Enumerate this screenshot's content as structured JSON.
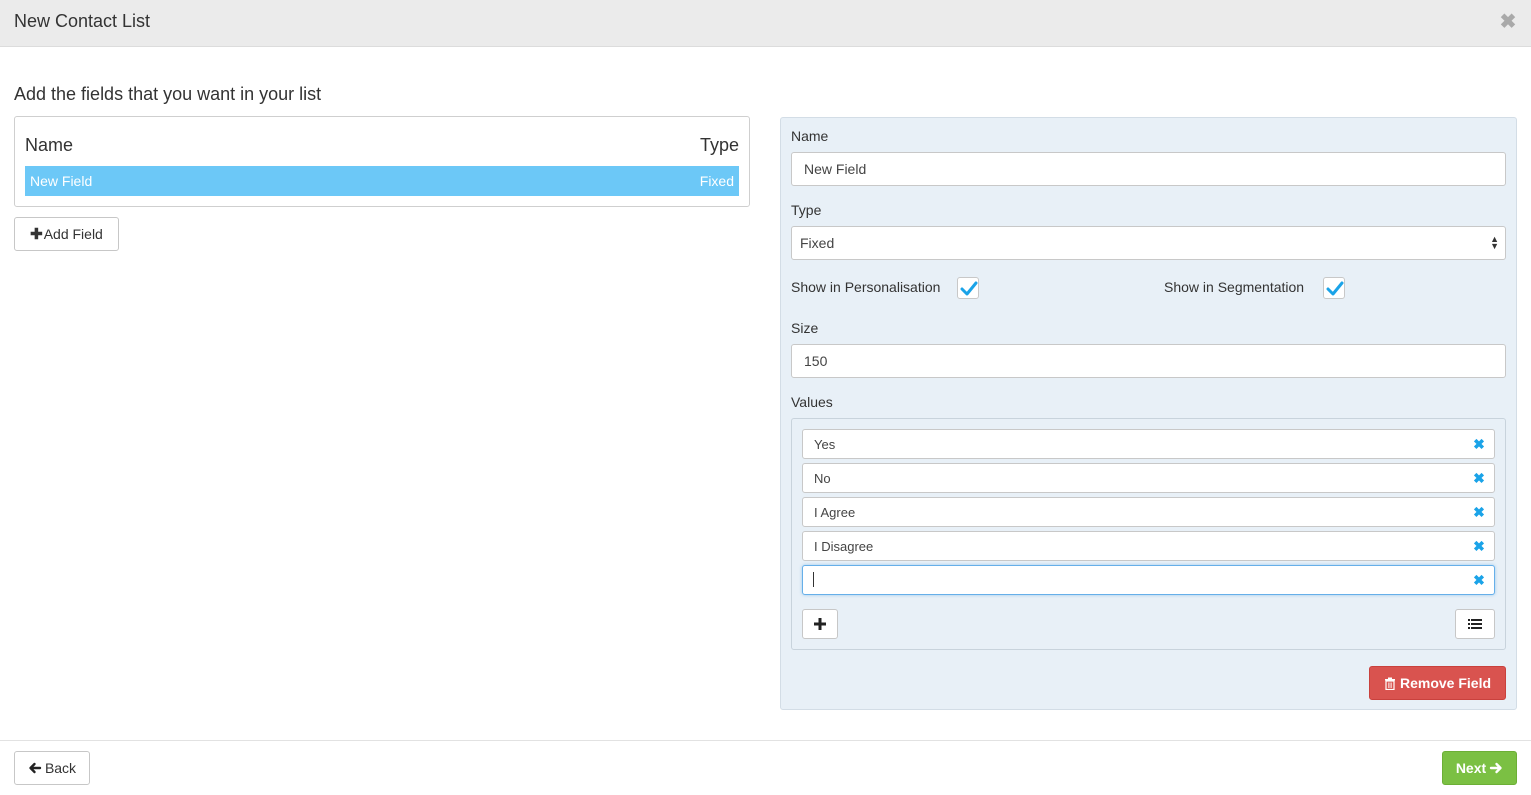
{
  "dialog": {
    "title": "New Contact List"
  },
  "instruction": "Add the fields that you want in your list",
  "field_table": {
    "columns": [
      "Name",
      "Type"
    ],
    "rows": [
      {
        "name": "New Field",
        "type": "Fixed"
      }
    ]
  },
  "add_field_label": "Add Field",
  "editor": {
    "name_label": "Name",
    "name_value": "New Field",
    "type_label": "Type",
    "type_value": "Fixed",
    "show_personalisation_label": "Show in Personalisation",
    "show_personalisation_checked": true,
    "show_segmentation_label": "Show in Segmentation",
    "show_segmentation_checked": true,
    "size_label": "Size",
    "size_value": "150",
    "values_label": "Values",
    "values": [
      "Yes",
      "No",
      "I Agree",
      "I Disagree",
      ""
    ],
    "remove_field_label": "Remove Field"
  },
  "footer": {
    "back_label": "Back",
    "next_label": "Next"
  },
  "colors": {
    "selection": "#6cc8f7",
    "panel": "#e8f0f7",
    "danger": "#d9534f",
    "success": "#7bc043",
    "checkmark": "#1aa3e8"
  },
  "icons": [
    "close-icon",
    "plus-icon",
    "checkmark-icon",
    "remove-x-icon",
    "list-icon",
    "trash-icon",
    "arrow-left-icon",
    "arrow-right-icon",
    "select-arrows-icon"
  ]
}
